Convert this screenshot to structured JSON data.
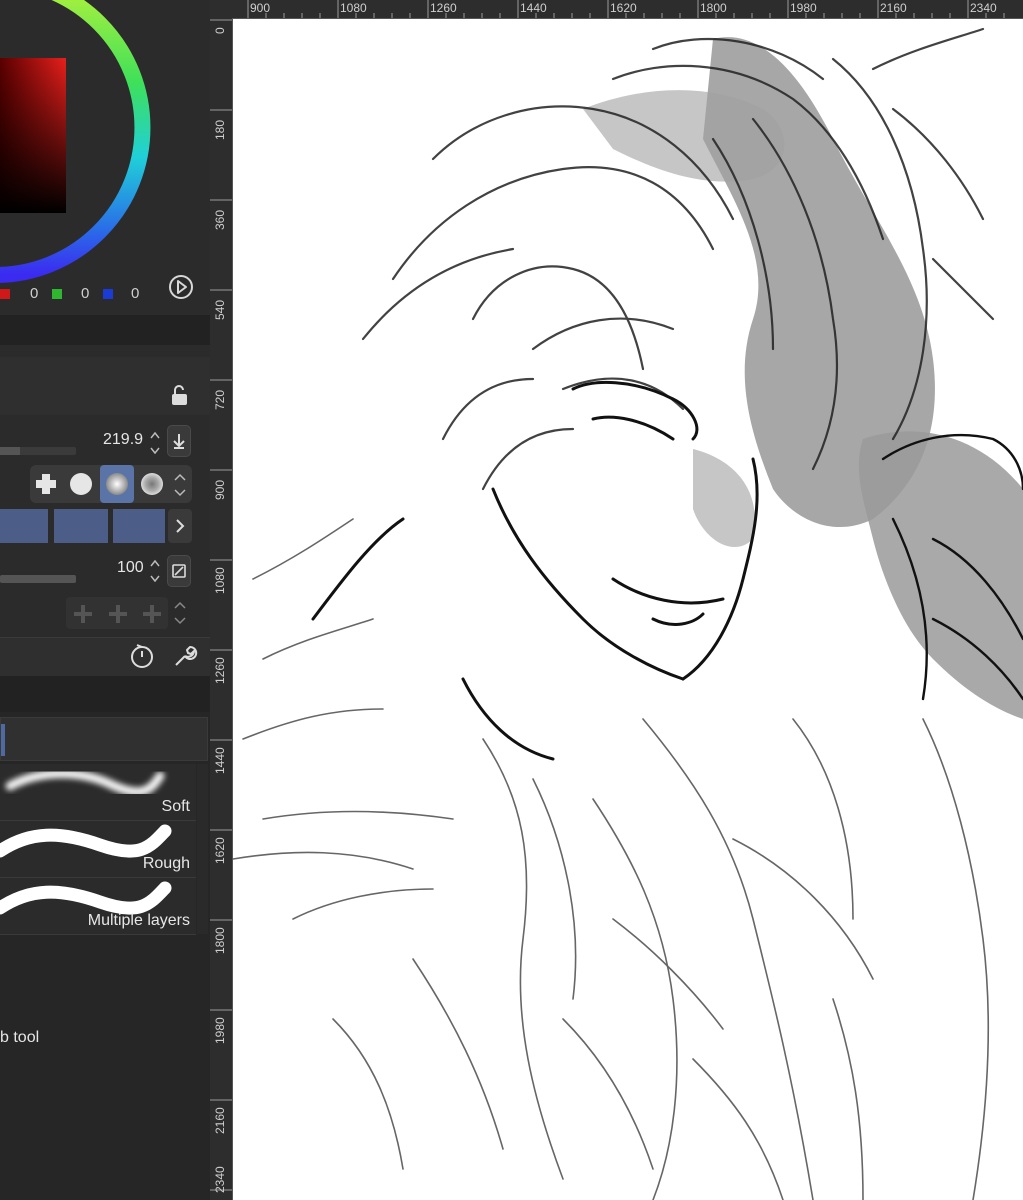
{
  "color_panel": {
    "rgb": [
      {
        "value": "0",
        "color": "#d01818"
      },
      {
        "value": "0",
        "color": "#2fb82f"
      },
      {
        "value": "0",
        "color": "#1a3bd6"
      }
    ]
  },
  "tool_property": {
    "size_value": "219.9",
    "opacity_value": "100"
  },
  "brushes": [
    {
      "name": "Soft"
    },
    {
      "name": "Rough"
    },
    {
      "name": "Multiple layers"
    }
  ],
  "bottom_label": "b tool",
  "ruler": {
    "top": [
      "900",
      "1080",
      "1260",
      "1440",
      "1620",
      "1800",
      "1980",
      "2160",
      "2340"
    ],
    "left": [
      "0",
      "180",
      "360",
      "540",
      "720",
      "900",
      "1080",
      "1260",
      "1440",
      "1620",
      "1800",
      "1980",
      "2160",
      "2340"
    ]
  }
}
